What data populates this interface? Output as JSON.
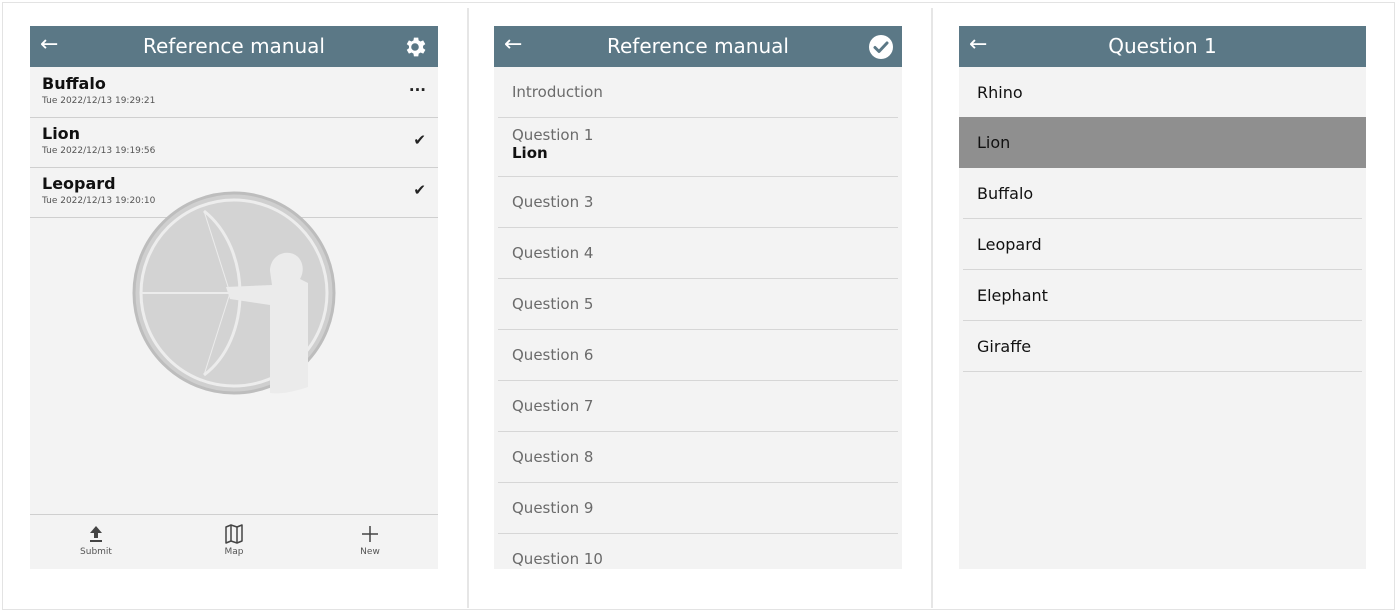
{
  "panel1": {
    "title": "Reference manual",
    "records": [
      {
        "name": "Buffalo",
        "date": "Tue 2022/12/13 19:29:21",
        "status": "···"
      },
      {
        "name": "Lion",
        "date": "Tue 2022/12/13 19:19:56",
        "status": "✔"
      },
      {
        "name": "Leopard",
        "date": "Tue 2022/12/13 19:20:10",
        "status": "✔"
      }
    ],
    "bottom": {
      "submit": "Submit",
      "map": "Map",
      "new": "New"
    }
  },
  "panel2": {
    "title": "Reference manual",
    "items": [
      {
        "label": "Introduction"
      },
      {
        "label": "Question 1",
        "answer": "Lion"
      },
      {
        "label": "Question 3"
      },
      {
        "label": "Question 4"
      },
      {
        "label": "Question 5"
      },
      {
        "label": "Question 6"
      },
      {
        "label": "Question 7"
      },
      {
        "label": "Question 8"
      },
      {
        "label": "Question 9"
      },
      {
        "label": "Question 10"
      }
    ]
  },
  "panel3": {
    "title": "Question 1",
    "options": [
      "Rhino",
      "Lion",
      "Buffalo",
      "Leopard",
      "Elephant",
      "Giraffe"
    ],
    "selected": "Lion"
  },
  "colors": {
    "header": "#5b7886",
    "panel_bg": "#f3f3f3",
    "selected_row": "#8f8f8f"
  }
}
